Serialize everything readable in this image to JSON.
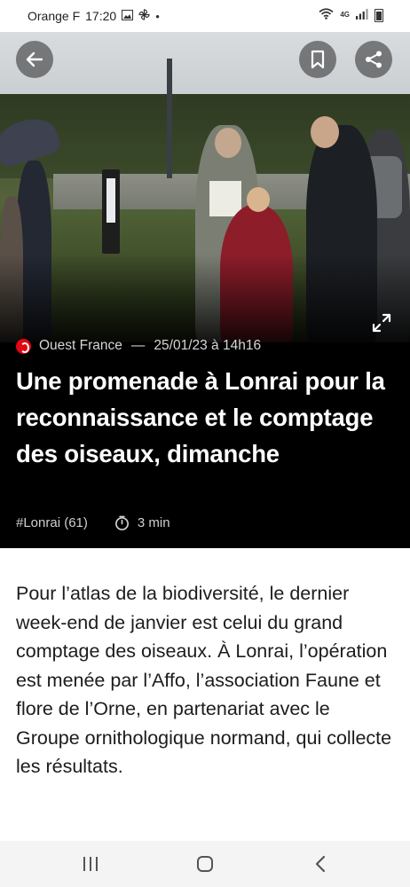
{
  "status_bar": {
    "carrier": "Orange F",
    "time": "17:20",
    "network": "4G"
  },
  "article": {
    "source": "Ouest France",
    "separator": "—",
    "date": "25/01/23 à 14h16",
    "title": "Une promenade à Lonrai pour la reconnaissance et le comptage des oiseaux, dimanche",
    "tag": "#Lonrai (61)",
    "read_time": "3 min",
    "body": "Pour l’atlas de la biodiversité, le dernier week-end de janvier est celui du grand comptage des oiseaux. À Lonrai, l’opération est menée par l’Affo, l’association Faune et flore de l’Orne, en partenariat avec le Groupe ornithologique normand, qui collecte les résultats."
  },
  "colors": {
    "brand": "#e30613",
    "hero_background": "#000000",
    "body_text": "#1c1c1c"
  },
  "icons": {
    "back": "arrow-left",
    "bookmark": "bookmark",
    "share": "share",
    "expand": "expand-arrows",
    "timer": "stopwatch",
    "nav_recents": "recents",
    "nav_home": "home",
    "nav_back": "chevron-left"
  }
}
